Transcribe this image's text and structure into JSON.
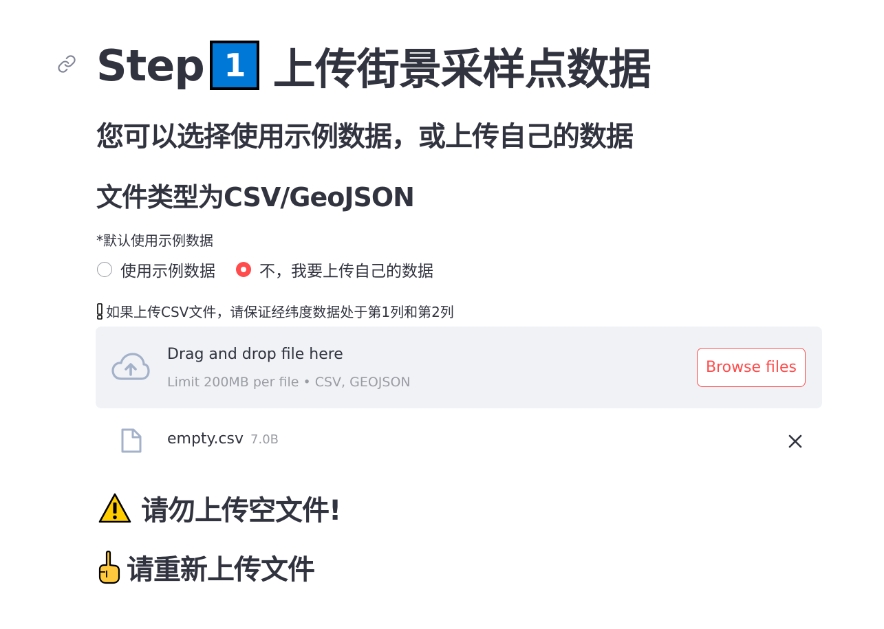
{
  "header": {
    "title_prefix": "Step",
    "step_number": "1",
    "title_main": "上传街景采样点数据",
    "anchor_icon": "link-icon"
  },
  "subheader": {
    "line1": "您可以选择使用示例数据，或上传自己的数据",
    "line2": "文件类型为CSV/GeoJSON"
  },
  "data_source": {
    "caption": "*默认使用示例数据",
    "options": [
      {
        "label": "使用示例数据",
        "selected": false
      },
      {
        "label": "不，我要上传自己的数据",
        "selected": true
      }
    ]
  },
  "upload": {
    "note_icon": "exclamation-icon",
    "note": "如果上传CSV文件，请保证经纬度数据处于第1列和第2列",
    "dropzone_icon": "cloud-upload-icon",
    "dropzone_title": "Drag and drop file here",
    "dropzone_limit": "Limit 200MB per file • CSV, GEOJSON",
    "browse_label": "Browse files"
  },
  "uploaded_file": {
    "icon": "file-icon",
    "name": "empty.csv",
    "size": "7.0B",
    "remove_icon": "close-icon"
  },
  "messages": {
    "warning_icon": "warning-icon",
    "warning": "请勿上传空文件!",
    "pointer_icon": "pointing-up-icon",
    "retry": "请重新上传文件"
  },
  "colors": {
    "text": "#31333f",
    "accent": "#ff4b4b",
    "muted": "#9a9ca3",
    "dropzone_bg": "#f0f2f6",
    "keycap_blue": "#0078d7",
    "icon_slate": "#a3b1c9"
  }
}
